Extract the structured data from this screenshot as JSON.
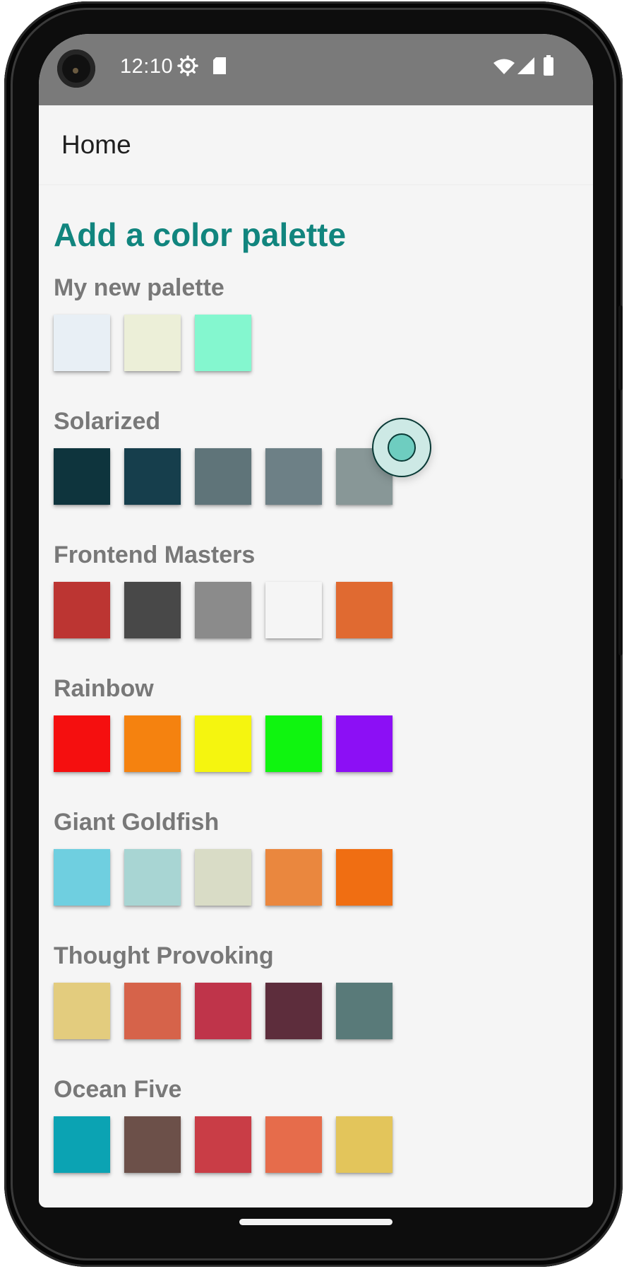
{
  "status_bar": {
    "time": "12:10",
    "icons": [
      "settings-icon",
      "sd-card-icon",
      "wifi-icon",
      "signal-icon",
      "battery-icon"
    ]
  },
  "app_bar": {
    "title": "Home"
  },
  "heading": "Add a color palette",
  "palettes": [
    {
      "name": "My new palette",
      "colors": [
        "#e8eff5",
        "#ecefd8",
        "#84f7cf"
      ]
    },
    {
      "name": "Solarized",
      "colors": [
        "#0e343d",
        "#163e4c",
        "#5f7479",
        "#6d8086",
        "#889797"
      ]
    },
    {
      "name": "Frontend Masters",
      "colors": [
        "#bc3532",
        "#484848",
        "#8b8b8b",
        "#f5f5f5",
        "#e06a31"
      ]
    },
    {
      "name": "Rainbow",
      "colors": [
        "#f50f0f",
        "#f5820f",
        "#f5f50f",
        "#0ff50f",
        "#8c0ff5"
      ]
    },
    {
      "name": "Giant Goldfish",
      "colors": [
        "#6fcfe0",
        "#a8d5d3",
        "#d9dcc6",
        "#ea873e",
        "#f06e12"
      ]
    },
    {
      "name": "Thought Provoking",
      "colors": [
        "#e3cc7e",
        "#d6634a",
        "#bf344a",
        "#5d2d3c",
        "#597a79"
      ]
    },
    {
      "name": "Ocean Five",
      "colors": [
        "#0ba3b3",
        "#6c5049",
        "#c93d46",
        "#e66c4b",
        "#e3c55b"
      ]
    }
  ],
  "theme": {
    "accent": "#11857e",
    "status_bar_bg": "#7a7a7a",
    "background": "#f5f5f5"
  }
}
